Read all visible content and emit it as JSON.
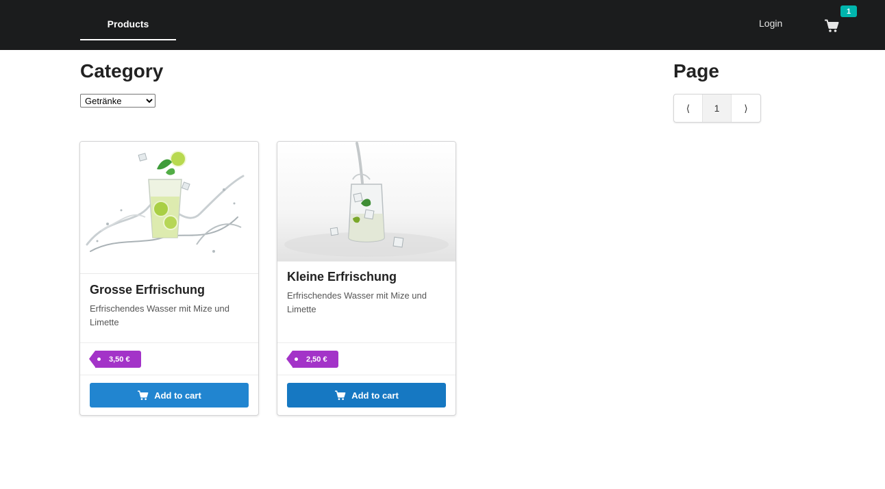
{
  "navbar": {
    "products_label": "Products",
    "login_label": "Login",
    "cart_count": "1",
    "cart_icon": "cart-icon"
  },
  "category": {
    "title": "Category",
    "selected": "Getränke"
  },
  "pagination": {
    "title": "Page",
    "prev": "⟨",
    "current": "1",
    "next": "⟩"
  },
  "products": [
    {
      "name": "Grosse Erfrischung",
      "description": "Erfrischendes Wasser mit Mize und Limette",
      "price": "3,50 €",
      "button_label": "Add to cart"
    },
    {
      "name": "Kleine Erfrischung",
      "description": "Erfrischendes Wasser mit Mize und Limette",
      "price": "2,50 €",
      "button_label": "Add to cart"
    }
  ],
  "colors": {
    "navbar_bg": "#1b1c1d",
    "badge": "#00b5ad",
    "price_tag": "#a333c8",
    "button_primary": "#2185d0",
    "button_hover": "#1678c2"
  }
}
